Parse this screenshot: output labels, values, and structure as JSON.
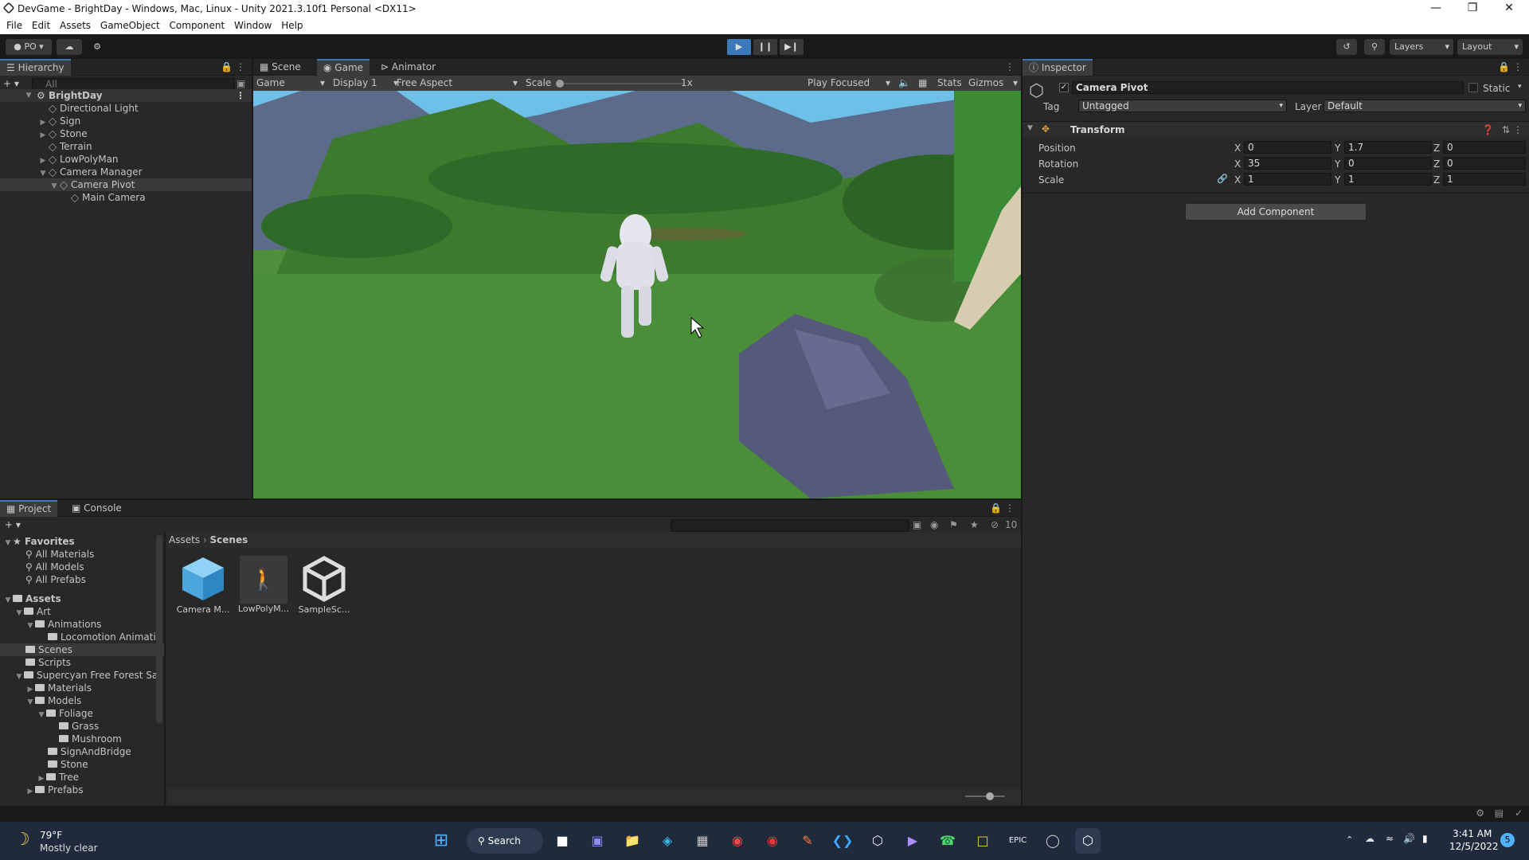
{
  "window": {
    "title": "DevGame - BrightDay - Windows, Mac, Linux - Unity 2021.3.10f1 Personal <DX11>"
  },
  "menu": [
    "File",
    "Edit",
    "Assets",
    "GameObject",
    "Component",
    "Window",
    "Help"
  ],
  "toolbar": {
    "account": "PO",
    "layers": "Layers",
    "layout": "Layout"
  },
  "hierarchy": {
    "tab": "Hierarchy",
    "search_placeholder": "All",
    "scene": "BrightDay",
    "items": [
      {
        "label": "Directional Light"
      },
      {
        "label": "Sign"
      },
      {
        "label": "Stone"
      },
      {
        "label": "Terrain"
      },
      {
        "label": "LowPolyMan"
      },
      {
        "label": "Camera Manager"
      },
      {
        "label": "Camera Pivot"
      },
      {
        "label": "Main Camera"
      }
    ]
  },
  "view": {
    "tabs": [
      "Scene",
      "Game",
      "Animator"
    ],
    "game_dropdown": "Game",
    "display": "Display 1",
    "aspect": "Free Aspect",
    "scale_label": "Scale",
    "scale_value": "1x",
    "play_mode": "Play Focused",
    "stats": "Stats",
    "gizmos": "Gizmos"
  },
  "inspector": {
    "tab": "Inspector",
    "object_name": "Camera Pivot",
    "static": "Static",
    "tag_label": "Tag",
    "tag_value": "Untagged",
    "layer_label": "Layer",
    "layer_value": "Default",
    "component": "Transform",
    "rows": [
      {
        "label": "Position",
        "x": "0",
        "y": "1.7",
        "z": "0"
      },
      {
        "label": "Rotation",
        "x": "35",
        "y": "0",
        "z": "0"
      },
      {
        "label": "Scale",
        "x": "1",
        "y": "1",
        "z": "1"
      }
    ],
    "axis": {
      "x": "X",
      "y": "Y",
      "z": "Z"
    },
    "add_component": "Add Component"
  },
  "project": {
    "tabs": [
      "Project",
      "Console"
    ],
    "hidden_count": "10",
    "favorites_label": "Favorites",
    "favorites": [
      "All Materials",
      "All Models",
      "All Prefabs"
    ],
    "assets_label": "Assets",
    "tree": [
      {
        "label": "Art",
        "level": 1
      },
      {
        "label": "Animations",
        "level": 2
      },
      {
        "label": "Locomotion Animatio",
        "level": 3
      },
      {
        "label": "Scenes",
        "level": 1
      },
      {
        "label": "Scripts",
        "level": 1
      },
      {
        "label": "Supercyan Free Forest Sa",
        "level": 1
      },
      {
        "label": "Materials",
        "level": 2
      },
      {
        "label": "Models",
        "level": 2
      },
      {
        "label": "Foliage",
        "level": 3
      },
      {
        "label": "Grass",
        "level": 4
      },
      {
        "label": "Mushroom",
        "level": 4
      },
      {
        "label": "SignAndBridge",
        "level": 3
      },
      {
        "label": "Stone",
        "level": 3
      },
      {
        "label": "Tree",
        "level": 3
      },
      {
        "label": "Prefabs",
        "level": 2
      }
    ],
    "breadcrumb": [
      "Assets",
      "Scenes"
    ],
    "files": [
      {
        "label": "Camera M...",
        "icon": "prefab-cube-icon"
      },
      {
        "label": "LowPolyM...",
        "icon": "model-thumbnail-icon"
      },
      {
        "label": "SampleSc...",
        "icon": "unity-scene-icon"
      }
    ]
  },
  "taskbar": {
    "weather_temp": "79°F",
    "weather_desc": "Mostly clear",
    "search": "Search",
    "time": "3:41 AM",
    "date": "12/5/2022",
    "notif": "5"
  }
}
